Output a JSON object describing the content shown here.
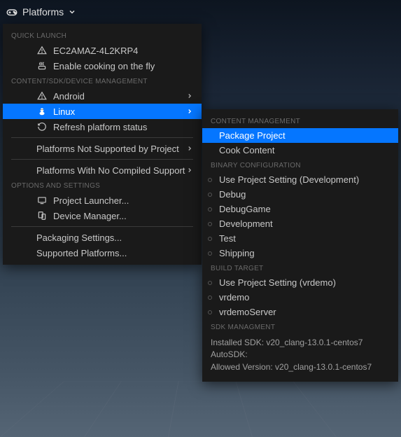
{
  "header": {
    "title": "Platforms"
  },
  "menu": {
    "sections": {
      "quick_launch": {
        "header": "QUICK LAUNCH",
        "items": [
          {
            "label": "EC2AMAZ-4L2KRP4"
          },
          {
            "label": "Enable cooking on the fly"
          }
        ]
      },
      "device_mgmt": {
        "header": "CONTENT/SDK/DEVICE MANAGEMENT",
        "items": [
          {
            "label": "Android"
          },
          {
            "label": "Linux"
          },
          {
            "label": "Refresh platform status"
          },
          {
            "label": "Platforms Not Supported by Project"
          },
          {
            "label": "Platforms With No Compiled Support"
          }
        ]
      },
      "options": {
        "header": "OPTIONS AND SETTINGS",
        "items": [
          {
            "label": "Project Launcher..."
          },
          {
            "label": "Device Manager..."
          },
          {
            "label": "Packaging Settings..."
          },
          {
            "label": "Supported Platforms..."
          }
        ]
      }
    }
  },
  "submenu": {
    "content_mgmt": {
      "header": "CONTENT MANAGEMENT",
      "items": [
        {
          "label": "Package Project"
        },
        {
          "label": "Cook Content"
        }
      ]
    },
    "binary_config": {
      "header": "BINARY CONFIGURATION",
      "items": [
        {
          "label": "Use Project Setting (Development)"
        },
        {
          "label": "Debug"
        },
        {
          "label": "DebugGame"
        },
        {
          "label": "Development"
        },
        {
          "label": "Test"
        },
        {
          "label": "Shipping"
        }
      ]
    },
    "build_target": {
      "header": "BUILD TARGET",
      "items": [
        {
          "label": "Use Project Setting (vrdemo)"
        },
        {
          "label": "vrdemo"
        },
        {
          "label": "vrdemoServer"
        }
      ]
    },
    "sdk": {
      "header": "SDK MANAGMENT",
      "installed": "Installed SDK: v20_clang-13.0.1-centos7",
      "auto": "AutoSDK:",
      "allowed": "Allowed Version: v20_clang-13.0.1-centos7"
    }
  }
}
